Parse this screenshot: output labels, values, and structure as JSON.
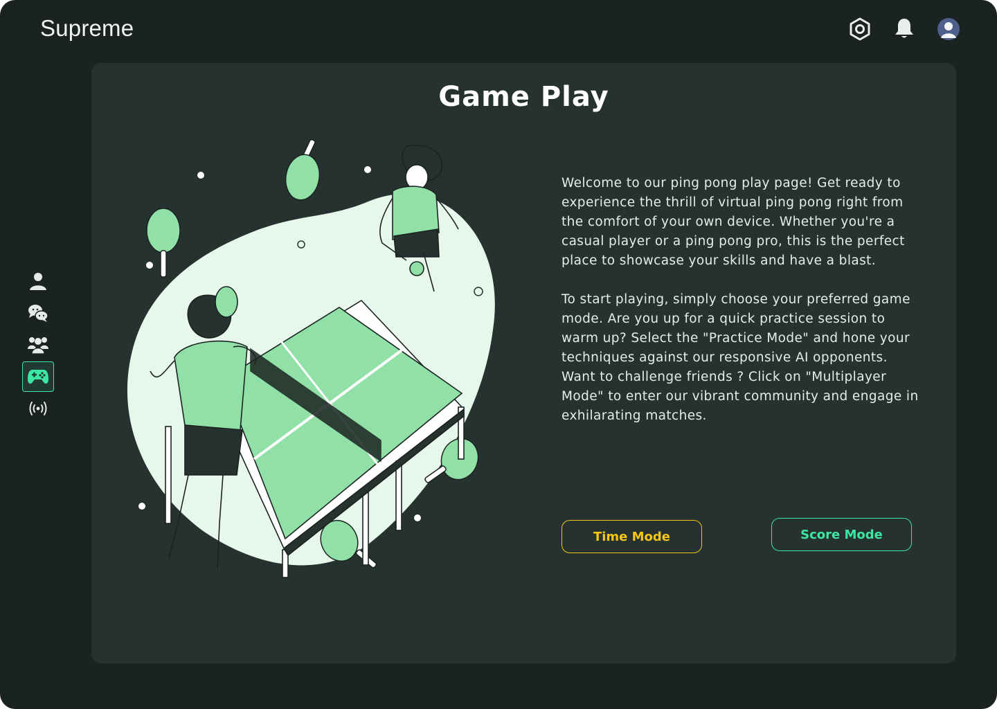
{
  "app": {
    "brand": "Supreme"
  },
  "header": {
    "icons": [
      "settings-hexagon-icon",
      "bell-icon",
      "user-avatar"
    ]
  },
  "sidebar": {
    "items": [
      {
        "icon": "user-icon",
        "active": false
      },
      {
        "icon": "chat-icon",
        "active": false
      },
      {
        "icon": "group-icon",
        "active": false
      },
      {
        "icon": "gamepad-icon",
        "active": true
      },
      {
        "icon": "broadcast-icon",
        "active": false
      }
    ]
  },
  "main": {
    "title": "Game Play",
    "paragraph1": "Welcome to our ping pong play page! Get ready to experience the thrill of virtual ping pong right from the comfort of your own device. Whether you're a casual player or a ping pong pro, this is the perfect place to showcase your skills and have a blast.",
    "paragraph2": "To start playing, simply choose your preferred game mode. Are you up for a quick practice session to warm up? Select the \"Practice Mode\" and hone your techniques against our responsive AI opponents. Want to challenge friends ? Click on \"Multiplayer Mode\" to enter our vibrant community and engage in exhilarating matches.",
    "buttons": {
      "time_mode": "Time Mode",
      "score_mode": "Score Mode"
    }
  },
  "colors": {
    "background": "#1a2321",
    "panel": "#253230",
    "accent_green": "#3ee6a3",
    "accent_yellow": "#f5c518",
    "table_green": "#91e0a7"
  }
}
